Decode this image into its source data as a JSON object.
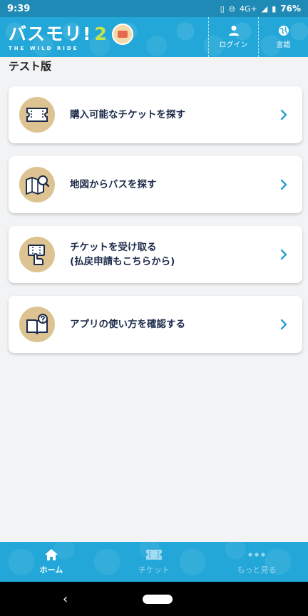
{
  "status": {
    "time": "9:39",
    "network": "4G+",
    "battery": "76%"
  },
  "header": {
    "logo_text": "バスモリ!",
    "logo_number": "2",
    "logo_subtitle": "THE WILD RIDE",
    "login_label": "ログイン",
    "language_label": "言語"
  },
  "page": {
    "title": "テスト版"
  },
  "menu": {
    "items": [
      {
        "label": "購入可能なチケットを探す",
        "label2": "",
        "icon": "ticket-icon"
      },
      {
        "label": "地図からバスを探す",
        "label2": "",
        "icon": "map-search-icon"
      },
      {
        "label": "チケットを受け取る",
        "label2": "(払戻申請もこちらから)",
        "icon": "receive-ticket-icon"
      },
      {
        "label": "アプリの使い方を確認する",
        "label2": "",
        "icon": "help-book-icon"
      }
    ]
  },
  "bottom_nav": {
    "home": "ホーム",
    "ticket": "チケット",
    "more": "もっと見る"
  },
  "colors": {
    "accent": "#22a7d8",
    "icon_bg": "#dcc391",
    "chevron": "#2a9fd0",
    "text": "#1d2b4a"
  }
}
